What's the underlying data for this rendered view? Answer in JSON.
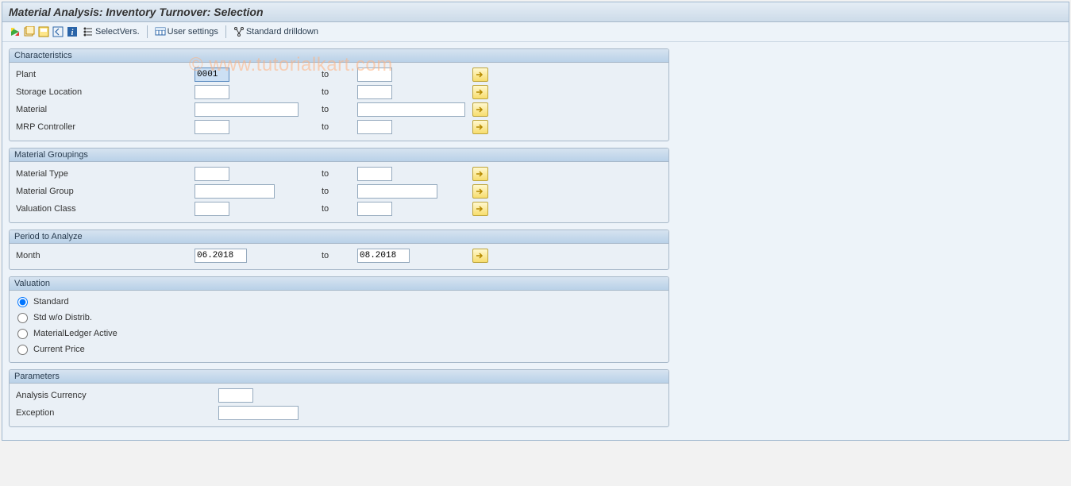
{
  "title": "Material Analysis: Inventory Turnover: Selection",
  "toolbar": {
    "select_vers": "SelectVers.",
    "user_settings": "User settings",
    "standard_drilldown": "Standard drilldown"
  },
  "watermark": "© www.tutorialkart.com",
  "panels": {
    "characteristics": {
      "title": "Characteristics",
      "plant": {
        "label": "Plant",
        "from": "0001",
        "to": ""
      },
      "storage_loc": {
        "label": "Storage Location",
        "from": "",
        "to": ""
      },
      "material": {
        "label": "Material",
        "from": "",
        "to": ""
      },
      "mrp_controller": {
        "label": "MRP Controller",
        "from": "",
        "to": ""
      }
    },
    "material_groupings": {
      "title": "Material Groupings",
      "material_type": {
        "label": "Material Type",
        "from": "",
        "to": ""
      },
      "material_group": {
        "label": "Material Group",
        "from": "",
        "to": ""
      },
      "valuation_class": {
        "label": "Valuation Class",
        "from": "",
        "to": ""
      }
    },
    "period": {
      "title": "Period to Analyze",
      "month": {
        "label": "Month",
        "from": "06.2018",
        "to": "08.2018"
      }
    },
    "valuation": {
      "title": "Valuation",
      "options": [
        {
          "id": "val-standard",
          "label": "Standard",
          "checked": true
        },
        {
          "id": "val-stdwo",
          "label": "Std w/o Distrib.",
          "checked": false
        },
        {
          "id": "val-mlactive",
          "label": "MaterialLedger Active",
          "checked": false
        },
        {
          "id": "val-curprice",
          "label": "Current Price",
          "checked": false
        }
      ]
    },
    "parameters": {
      "title": "Parameters",
      "analysis_currency": {
        "label": "Analysis Currency",
        "value": ""
      },
      "exception": {
        "label": "Exception",
        "value": ""
      }
    }
  },
  "to_label": "to"
}
